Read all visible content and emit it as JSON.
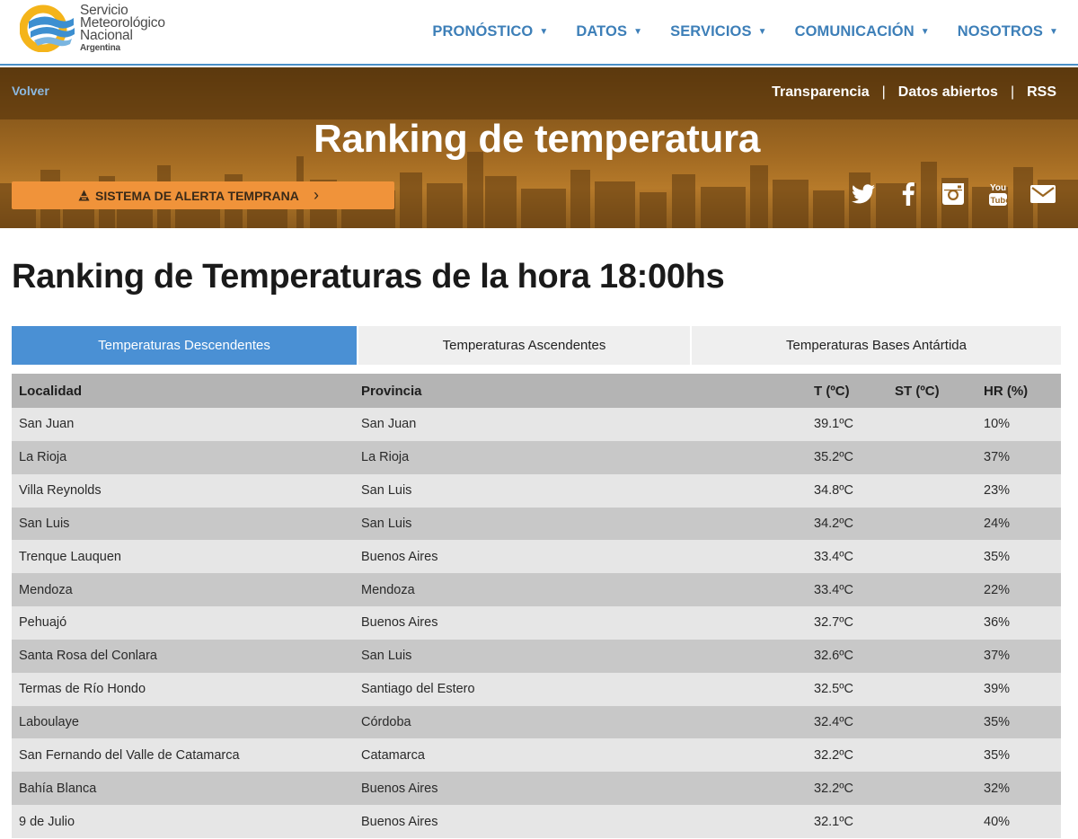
{
  "logo": {
    "line1": "Servicio",
    "line2": "Meteorológico",
    "line3": "Nacional",
    "line4": "Argentina"
  },
  "nav": [
    {
      "label": "PRONÓSTICO"
    },
    {
      "label": "DATOS"
    },
    {
      "label": "SERVICIOS"
    },
    {
      "label": "COMUNICACIÓN"
    },
    {
      "label": "NOSOTROS"
    }
  ],
  "banner": {
    "back": "Volver",
    "links": [
      "Transparencia",
      "Datos abiertos",
      "RSS"
    ],
    "separator": "|",
    "title": "Ranking de temperatura",
    "alert_button": "SISTEMA DE ALERTA TEMPRANA",
    "social_icons": [
      "twitter-icon",
      "facebook-icon",
      "instagram-icon",
      "youtube-icon",
      "mail-icon"
    ]
  },
  "heading": "Ranking de Temperaturas de la hora 18:00hs",
  "tabs": [
    {
      "label": "Temperaturas Descendentes",
      "active": true
    },
    {
      "label": "Temperaturas Ascendentes",
      "active": false
    },
    {
      "label": "Temperaturas Bases Antártida",
      "active": false
    }
  ],
  "table": {
    "headers": [
      "Localidad",
      "Provincia",
      "T (ºC)",
      "ST (ºC)",
      "HR (%)"
    ],
    "rows": [
      [
        "San Juan",
        "San Juan",
        "39.1ºC",
        "",
        "10%"
      ],
      [
        "La Rioja",
        "La Rioja",
        "35.2ºC",
        "",
        "37%"
      ],
      [
        "Villa Reynolds",
        "San Luis",
        "34.8ºC",
        "",
        "23%"
      ],
      [
        "San Luis",
        "San Luis",
        "34.2ºC",
        "",
        "24%"
      ],
      [
        "Trenque Lauquen",
        "Buenos Aires",
        "33.4ºC",
        "",
        "35%"
      ],
      [
        "Mendoza",
        "Mendoza",
        "33.4ºC",
        "",
        "22%"
      ],
      [
        "Pehuajó",
        "Buenos Aires",
        "32.7ºC",
        "",
        "36%"
      ],
      [
        "Santa Rosa del Conlara",
        "San Luis",
        "32.6ºC",
        "",
        "37%"
      ],
      [
        "Termas de Río Hondo",
        "Santiago del Estero",
        "32.5ºC",
        "",
        "39%"
      ],
      [
        "Laboulaye",
        "Córdoba",
        "32.4ºC",
        "",
        "35%"
      ],
      [
        "San Fernando del Valle de Catamarca",
        "Catamarca",
        "32.2ºC",
        "",
        "35%"
      ],
      [
        "Bahía Blanca",
        "Buenos Aires",
        "32.2ºC",
        "",
        "32%"
      ],
      [
        "9 de Julio",
        "Buenos Aires",
        "32.1ºC",
        "",
        "40%"
      ]
    ]
  },
  "colors": {
    "nav_text": "#3d7fb8",
    "active_tab": "#4a90d4",
    "alert_button": "#f0933a",
    "header_row": "#b4b4b4",
    "row_light": "#e6e6e6",
    "row_dark": "#c8c8c8"
  }
}
